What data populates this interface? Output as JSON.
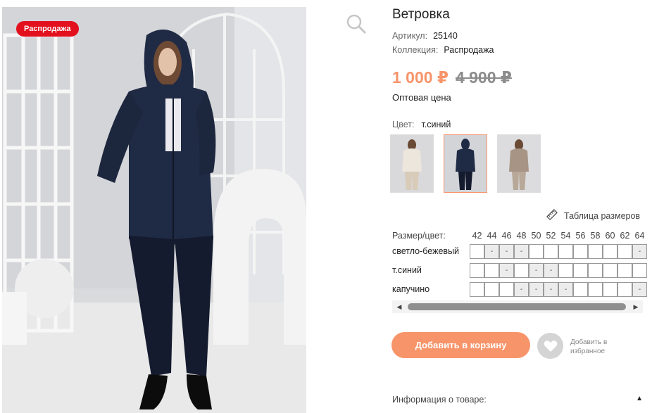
{
  "badge": {
    "sale": "Распродажа"
  },
  "icons": {
    "zoom": "search-icon",
    "ruler": "ruler-icon",
    "heart": "heart-icon",
    "scroll_left": "chevron-left-icon",
    "scroll_right": "chevron-right-icon",
    "toggle": "triangle-up-icon"
  },
  "product": {
    "title": "Ветровка",
    "article_label": "Артикул:",
    "article_value": "25140",
    "collection_label": "Коллекция:",
    "collection_value": "Распродажа",
    "price_current": "1 000 ₽",
    "price_old": "4 900 ₽",
    "wholesale_label": "Оптовая цена",
    "color_label": "Цвет:",
    "color_value": "т.синий"
  },
  "thumbnails": [
    {
      "color": "светло-бежевый",
      "selected": false
    },
    {
      "color": "т.синий",
      "selected": true
    },
    {
      "color": "капучино",
      "selected": false
    }
  ],
  "size_table_link": "Таблица размеров",
  "size_grid": {
    "header_label": "Размер/цвет:",
    "sizes": [
      "42",
      "44",
      "46",
      "48",
      "50",
      "52",
      "54",
      "56",
      "58",
      "60",
      "62",
      "64"
    ],
    "rows": [
      {
        "label": "светло-бежевый",
        "cells": [
          "",
          "-",
          "-",
          "-",
          "",
          "",
          "",
          "",
          "",
          "",
          "",
          "-"
        ]
      },
      {
        "label": "т.синий",
        "cells": [
          "",
          "",
          "-",
          "",
          "-",
          "-",
          "",
          "",
          "",
          "",
          "",
          ""
        ]
      },
      {
        "label": "капучино",
        "cells": [
          "",
          "",
          "",
          "-",
          "-",
          "-",
          "-",
          "",
          "",
          "",
          "",
          "-"
        ]
      }
    ]
  },
  "actions": {
    "add_to_cart": "Добавить в корзину",
    "add_to_favorites_line1": "Добавить в",
    "add_to_favorites_line2": "избранное"
  },
  "info_section": {
    "label": "Информация о товаре:"
  },
  "colors": {
    "accent": "#f7946a",
    "sale_badge": "#e3101e",
    "old_price": "#8c8c8c",
    "jacket": "#1f2a44"
  }
}
